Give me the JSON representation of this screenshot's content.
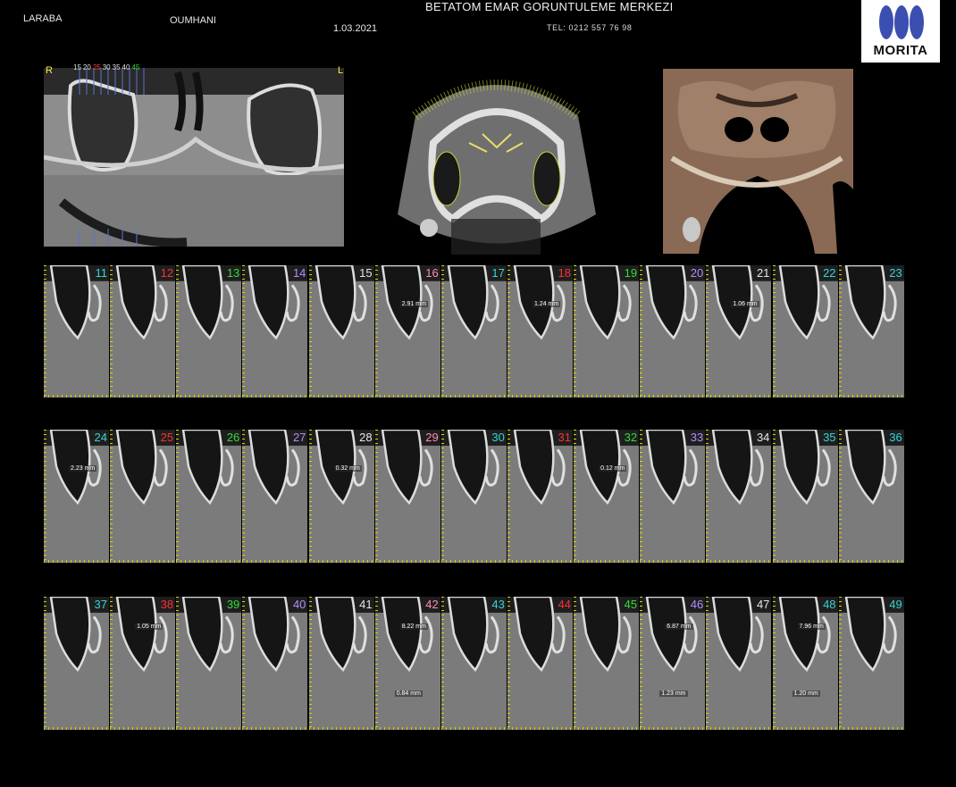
{
  "header": {
    "patient_last": "LARABA",
    "patient_first": "OUMHANI",
    "date": "1.03.2021",
    "center_name": "BETATOM EMAR GORUNTULEME MERKEZI",
    "phone": "TEL: 0212 557 76 98",
    "logo_text": "MORITA"
  },
  "panoramic": {
    "right_label": "R",
    "left_label": "L",
    "scale_ticks": [
      {
        "text": "15",
        "color": "#e0e0e0"
      },
      {
        "text": "20",
        "color": "#e0e0e0"
      },
      {
        "text": "25",
        "color": "#ff4040"
      },
      {
        "text": "30",
        "color": "#e0e0e0"
      },
      {
        "text": "35",
        "color": "#e0e0e0"
      },
      {
        "text": "40",
        "color": "#e0e0e0"
      },
      {
        "text": "45",
        "color": "#33dd33"
      }
    ]
  },
  "colors": {
    "cyan": "#33d6d6",
    "red": "#ff3030",
    "green": "#33dd33",
    "purple": "#b48cff",
    "white": "#e6e6e6",
    "ruler": "#d8d400"
  },
  "rows": [
    {
      "slices": [
        {
          "num": "11",
          "color": "#33d6d6",
          "meas": ""
        },
        {
          "num": "12",
          "color": "#ff3030",
          "meas": ""
        },
        {
          "num": "13",
          "color": "#33dd33",
          "meas": ""
        },
        {
          "num": "14",
          "color": "#b48cff",
          "meas": ""
        },
        {
          "num": "15",
          "color": "#e6e6e6",
          "meas": ""
        },
        {
          "num": "16",
          "color": "#ff8cb4",
          "meas": "2.91 mm"
        },
        {
          "num": "17",
          "color": "#33d6d6",
          "meas": ""
        },
        {
          "num": "18",
          "color": "#ff3030",
          "meas": "1.24 mm"
        },
        {
          "num": "19",
          "color": "#33dd33",
          "meas": ""
        },
        {
          "num": "20",
          "color": "#b48cff",
          "meas": ""
        },
        {
          "num": "21",
          "color": "#e6e6e6",
          "meas": "1.06 mm"
        },
        {
          "num": "22",
          "color": "#33d6d6",
          "meas": ""
        },
        {
          "num": "23",
          "color": "#33d6d6",
          "meas": ""
        }
      ]
    },
    {
      "slices": [
        {
          "num": "24",
          "color": "#33d6d6",
          "meas": "2.23 mm"
        },
        {
          "num": "25",
          "color": "#ff3030",
          "meas": ""
        },
        {
          "num": "26",
          "color": "#33dd33",
          "meas": ""
        },
        {
          "num": "27",
          "color": "#b48cff",
          "meas": ""
        },
        {
          "num": "28",
          "color": "#e6e6e6",
          "meas": "0.32 mm"
        },
        {
          "num": "29",
          "color": "#ff8cb4",
          "meas": ""
        },
        {
          "num": "30",
          "color": "#33d6d6",
          "meas": ""
        },
        {
          "num": "31",
          "color": "#ff3030",
          "meas": ""
        },
        {
          "num": "32",
          "color": "#33dd33",
          "meas": "0.12 mm"
        },
        {
          "num": "33",
          "color": "#b48cff",
          "meas": ""
        },
        {
          "num": "34",
          "color": "#e6e6e6",
          "meas": ""
        },
        {
          "num": "35",
          "color": "#33d6d6",
          "meas": ""
        },
        {
          "num": "36",
          "color": "#33d6d6",
          "meas": ""
        }
      ]
    },
    {
      "slices": [
        {
          "num": "37",
          "color": "#33d6d6",
          "meas": ""
        },
        {
          "num": "38",
          "color": "#ff3030",
          "meas": "1.05 mm"
        },
        {
          "num": "39",
          "color": "#33dd33",
          "meas": ""
        },
        {
          "num": "40",
          "color": "#b48cff",
          "meas": ""
        },
        {
          "num": "41",
          "color": "#e6e6e6",
          "meas": ""
        },
        {
          "num": "42",
          "color": "#ff8cb4",
          "meas": "8.22 mm",
          "meas2": "0.84 mm"
        },
        {
          "num": "43",
          "color": "#33d6d6",
          "meas": ""
        },
        {
          "num": "44",
          "color": "#ff3030",
          "meas": ""
        },
        {
          "num": "45",
          "color": "#33dd33",
          "meas": ""
        },
        {
          "num": "46",
          "color": "#b48cff",
          "meas": "6.87 mm",
          "meas2": "1.23 mm"
        },
        {
          "num": "47",
          "color": "#e6e6e6",
          "meas": ""
        },
        {
          "num": "48",
          "color": "#33d6d6",
          "meas": "7.96 mm",
          "meas2": "1.20 mm"
        },
        {
          "num": "49",
          "color": "#33d6d6",
          "meas": ""
        }
      ]
    }
  ]
}
